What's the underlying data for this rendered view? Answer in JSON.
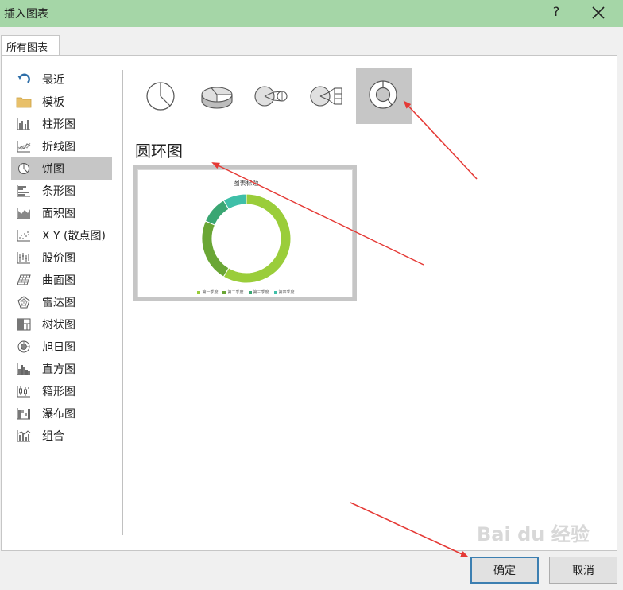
{
  "window": {
    "title": "插入图表",
    "help_label": "?"
  },
  "tabs": [
    {
      "label": "所有图表"
    }
  ],
  "sidebar": {
    "items": [
      {
        "label": "最近",
        "icon": "recent-icon"
      },
      {
        "label": "模板",
        "icon": "folder-icon"
      },
      {
        "label": "柱形图",
        "icon": "column-chart-icon"
      },
      {
        "label": "折线图",
        "icon": "line-chart-icon"
      },
      {
        "label": "饼图",
        "icon": "pie-chart-icon",
        "selected": true
      },
      {
        "label": "条形图",
        "icon": "bar-chart-icon"
      },
      {
        "label": "面积图",
        "icon": "area-chart-icon"
      },
      {
        "label": "X Y (散点图)",
        "icon": "scatter-chart-icon"
      },
      {
        "label": "股价图",
        "icon": "stock-chart-icon"
      },
      {
        "label": "曲面图",
        "icon": "surface-chart-icon"
      },
      {
        "label": "雷达图",
        "icon": "radar-chart-icon"
      },
      {
        "label": "树状图",
        "icon": "treemap-chart-icon"
      },
      {
        "label": "旭日图",
        "icon": "sunburst-chart-icon"
      },
      {
        "label": "直方图",
        "icon": "histogram-chart-icon"
      },
      {
        "label": "箱形图",
        "icon": "box-whisker-chart-icon"
      },
      {
        "label": "瀑布图",
        "icon": "waterfall-chart-icon"
      },
      {
        "label": "组合",
        "icon": "combo-chart-icon"
      }
    ]
  },
  "subtypes": [
    {
      "icon": "pie-icon"
    },
    {
      "icon": "3d-pie-icon"
    },
    {
      "icon": "pie-of-pie-icon"
    },
    {
      "icon": "bar-of-pie-icon"
    },
    {
      "icon": "doughnut-icon",
      "selected": true
    }
  ],
  "selected_chart": {
    "name": "圆环图"
  },
  "preview": {
    "chart_data": {
      "type": "doughnut",
      "title": "图表标题",
      "categories": [
        "第一季度",
        "第二季度",
        "第三季度",
        "第四季度"
      ],
      "values": [
        8.2,
        3.2,
        1.4,
        1.2
      ],
      "colors": [
        "#9acd3a",
        "#6aa635",
        "#3aa673",
        "#3fbfa8"
      ]
    }
  },
  "buttons": {
    "ok_label": "确定",
    "cancel_label": "取消"
  },
  "watermark": {
    "text": "Bai du 经验"
  },
  "colors": {
    "titlebar": "#a5d6a7",
    "selection": "#c6c6c6",
    "annotation_arrow": "#e53935"
  }
}
